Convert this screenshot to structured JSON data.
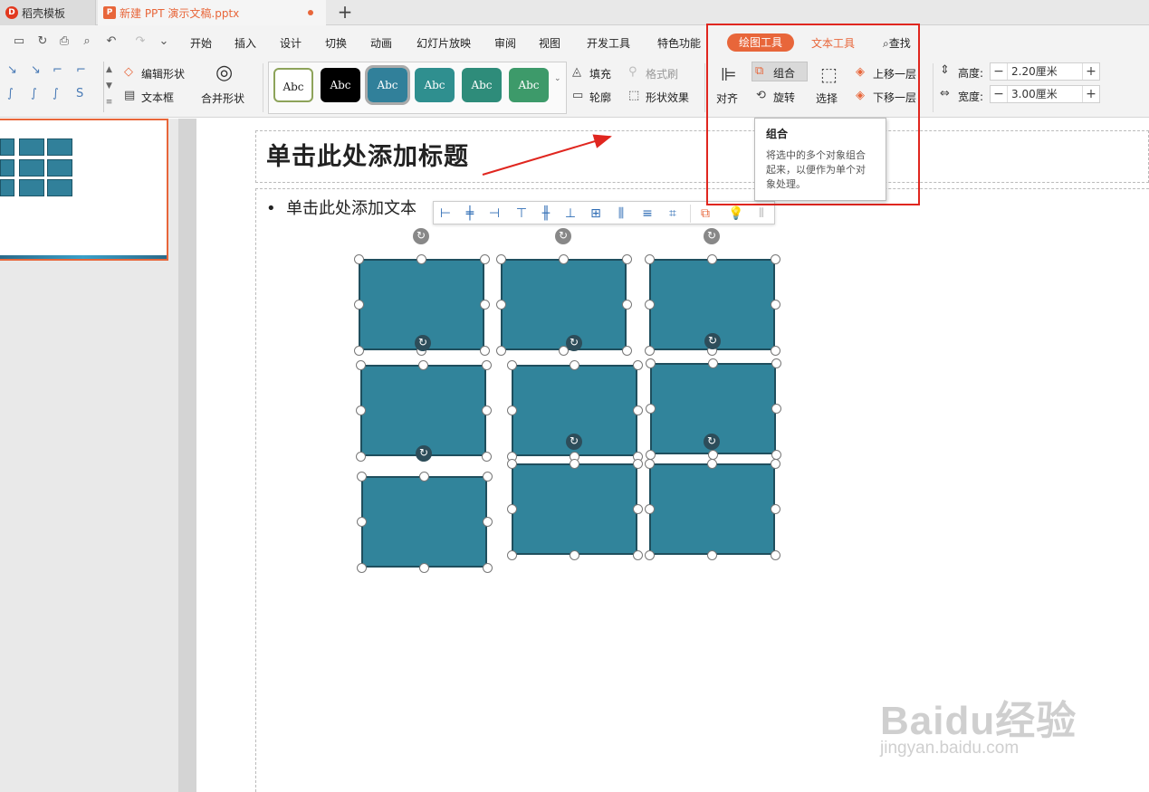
{
  "tabs": [
    {
      "label": "稻壳模板",
      "logo": "D"
    },
    {
      "label": "新建 PPT 演示文稿.pptx",
      "logo": "P"
    }
  ],
  "new_tab": "+",
  "menu": {
    "items": [
      "开始",
      "插入",
      "设计",
      "切换",
      "动画",
      "幻灯片放映",
      "审阅",
      "视图",
      "开发工具",
      "特色功能"
    ],
    "drawing_tools": "绘图工具",
    "text_tools": "文本工具",
    "search": "查找"
  },
  "ribbon": {
    "edit_shape": "编辑形状",
    "text_box": "文本框",
    "merge_shape": "合并形状",
    "style_samples": [
      "Abc",
      "Abc",
      "Abc",
      "Abc",
      "Abc",
      "Abc"
    ],
    "style_colors": [
      "#ffffff",
      "#000000",
      "#31809a",
      "#2f8f8f",
      "#2e8c7a",
      "#3d9a6a"
    ],
    "fill": "填充",
    "format_brush": "格式刷",
    "outline": "轮廓",
    "shape_effect": "形状效果",
    "align": "对齐",
    "group": "组合",
    "rotate": "旋转",
    "select": "选择",
    "bring_forward": "上移一层",
    "send_backward": "下移一层",
    "height_label": "高度:",
    "height_value": "2.20厘米",
    "width_label": "宽度:",
    "width_value": "3.00厘米"
  },
  "slide": {
    "title_placeholder": "单击此处添加标题",
    "body_placeholder": "单击此处添加文本"
  },
  "shape_color": "#31849b",
  "accent_color": "#e8663a",
  "tooltip": {
    "title": "组合",
    "description": "将选中的多个对象组合起来，以便作为单个对象处理。"
  },
  "watermark": {
    "brand": "Baidu经验",
    "url": "jingyan.baidu.com"
  }
}
